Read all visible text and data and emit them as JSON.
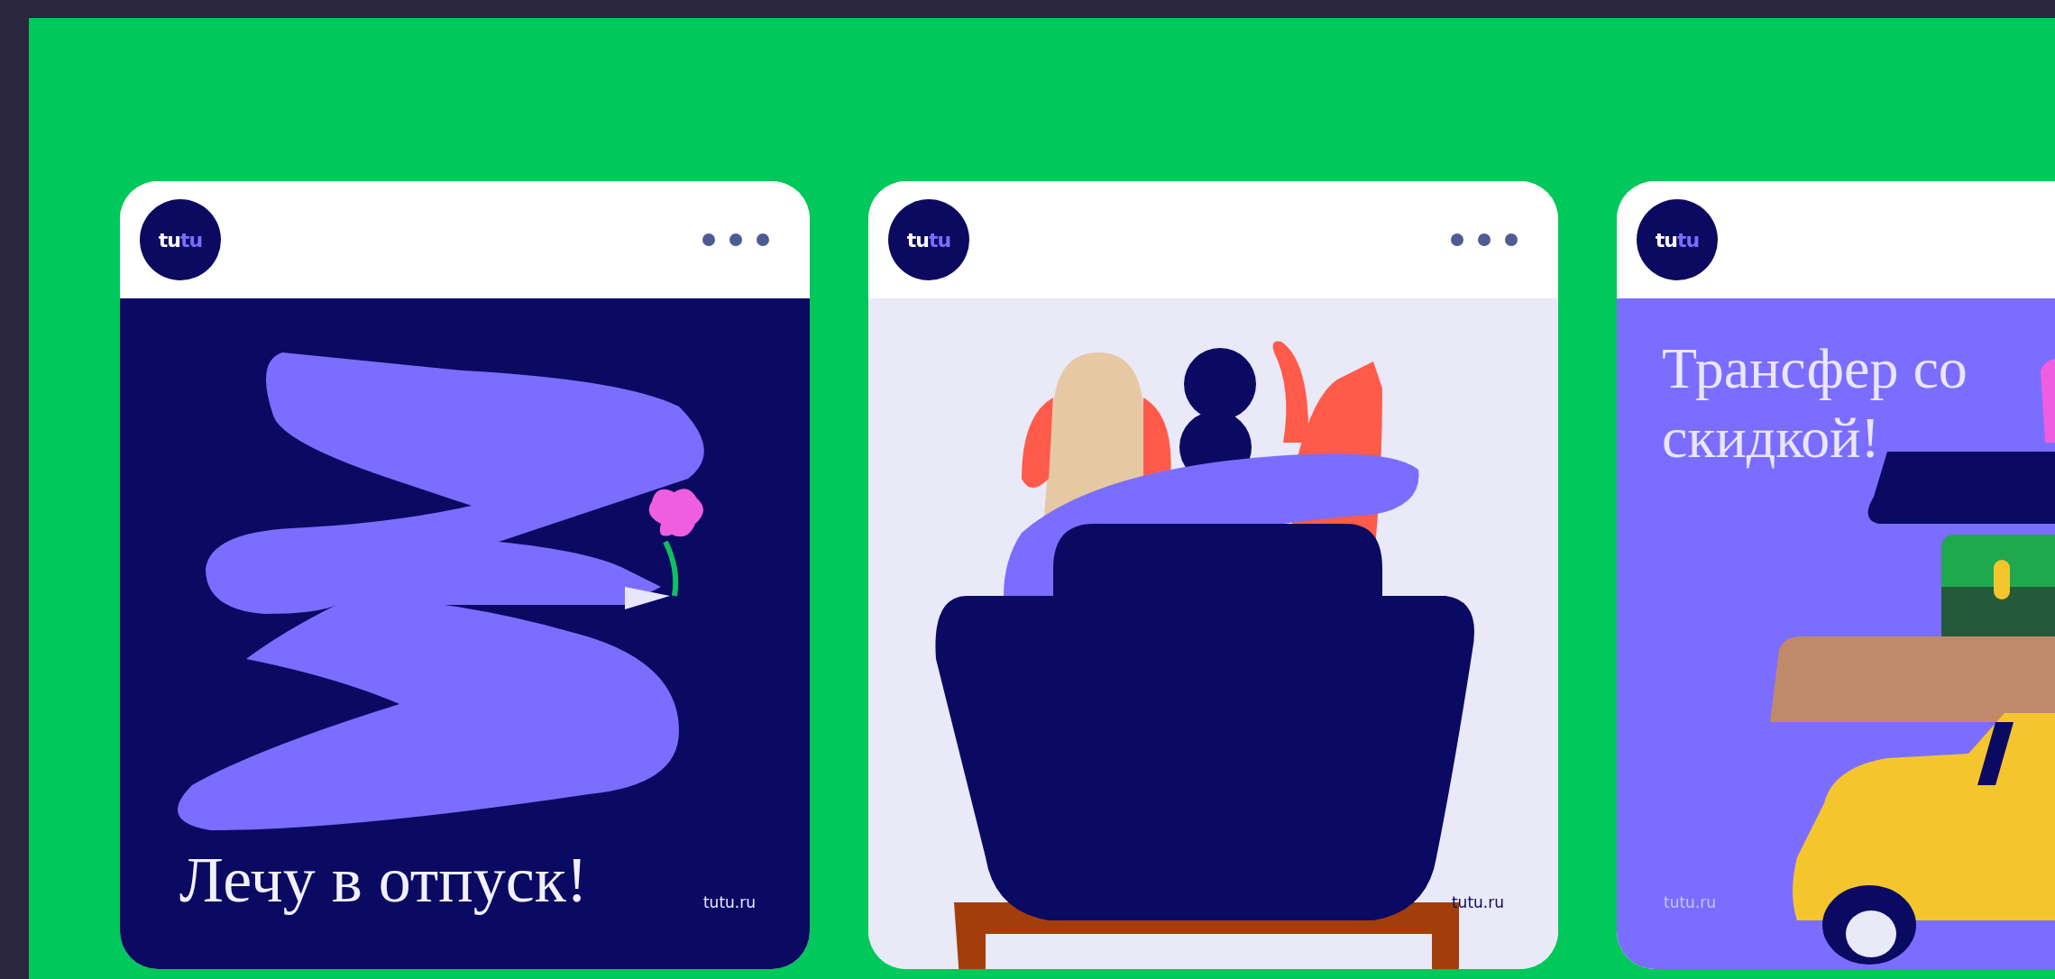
{
  "posts": [
    {
      "kind": "bird",
      "logo": "tutu",
      "caption": "Лечу в отпуск!",
      "footer": "tutu.ru"
    },
    {
      "kind": "sofa",
      "logo": "tutu",
      "footer": "tutu.ru"
    },
    {
      "kind": "transfer",
      "logo": "tutu",
      "caption": "Трансфер со скидкой!",
      "footer": "tutu.ru"
    }
  ]
}
